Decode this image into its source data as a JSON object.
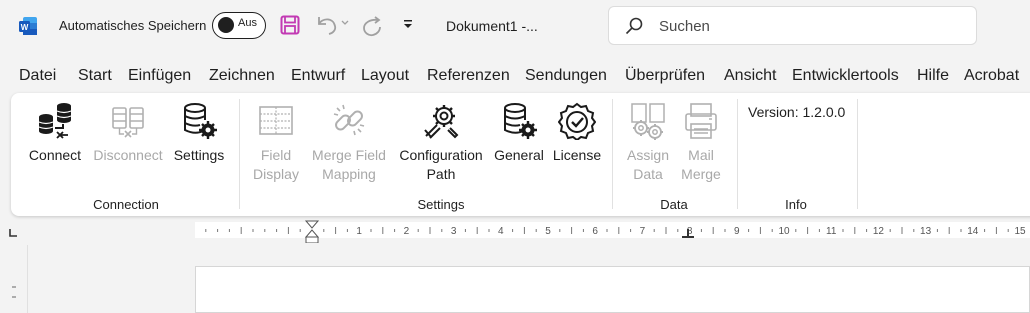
{
  "titlebar": {
    "autosave_label": "Automatisches Speichern",
    "autosave_toggle_text": "Aus",
    "document_title": "Dokument1  -...",
    "search_placeholder": "Suchen",
    "brand_color": "#185abd",
    "save_icon_color": "#c239b3"
  },
  "menu": {
    "tabs": [
      "Datei",
      "Start",
      "Einfügen",
      "Zeichnen",
      "Entwurf",
      "Layout",
      "Referenzen",
      "Sendungen",
      "Überprüfen",
      "Ansicht",
      "Entwicklertools",
      "Hilfe",
      "Acrobat"
    ]
  },
  "ribbon": {
    "groups": [
      {
        "label": "Connection"
      },
      {
        "label": "Settings"
      },
      {
        "label": "Data"
      },
      {
        "label": "Info"
      }
    ],
    "buttons": {
      "connect": {
        "line1": "Connect",
        "line2": "",
        "enabled": true,
        "icon": "database-connect-icon"
      },
      "disconnect": {
        "line1": "Disconnect",
        "line2": "",
        "enabled": false,
        "icon": "database-disconnect-icon"
      },
      "settings": {
        "line1": "Settings",
        "line2": "",
        "enabled": true,
        "icon": "database-gear-icon"
      },
      "field_display": {
        "line1": "Field",
        "line2": "Display",
        "enabled": false,
        "icon": "table-icon"
      },
      "merge_field_mapping": {
        "line1": "Merge Field",
        "line2": "Mapping",
        "enabled": false,
        "icon": "chain-link-icon"
      },
      "configuration_path": {
        "line1": "Configuration",
        "line2": "Path",
        "enabled": true,
        "icon": "wrench-gear-icon"
      },
      "general": {
        "line1": "General",
        "line2": "",
        "enabled": true,
        "icon": "database-gear-icon"
      },
      "license": {
        "line1": "License",
        "line2": "",
        "enabled": true,
        "icon": "verified-badge-icon"
      },
      "assign_data": {
        "line1": "Assign",
        "line2": "Data",
        "enabled": false,
        "icon": "gears-icon"
      },
      "mail_merge": {
        "line1": "Mail",
        "line2": "Merge",
        "enabled": false,
        "icon": "printer-icon"
      }
    },
    "version_text": "Version: 1.2.0.0"
  },
  "ruler": {
    "ticks": [
      "1",
      "2",
      "3",
      "4",
      "5",
      "6",
      "7",
      "8",
      "9",
      "10",
      "11",
      "12",
      "13",
      "14",
      "15"
    ]
  }
}
